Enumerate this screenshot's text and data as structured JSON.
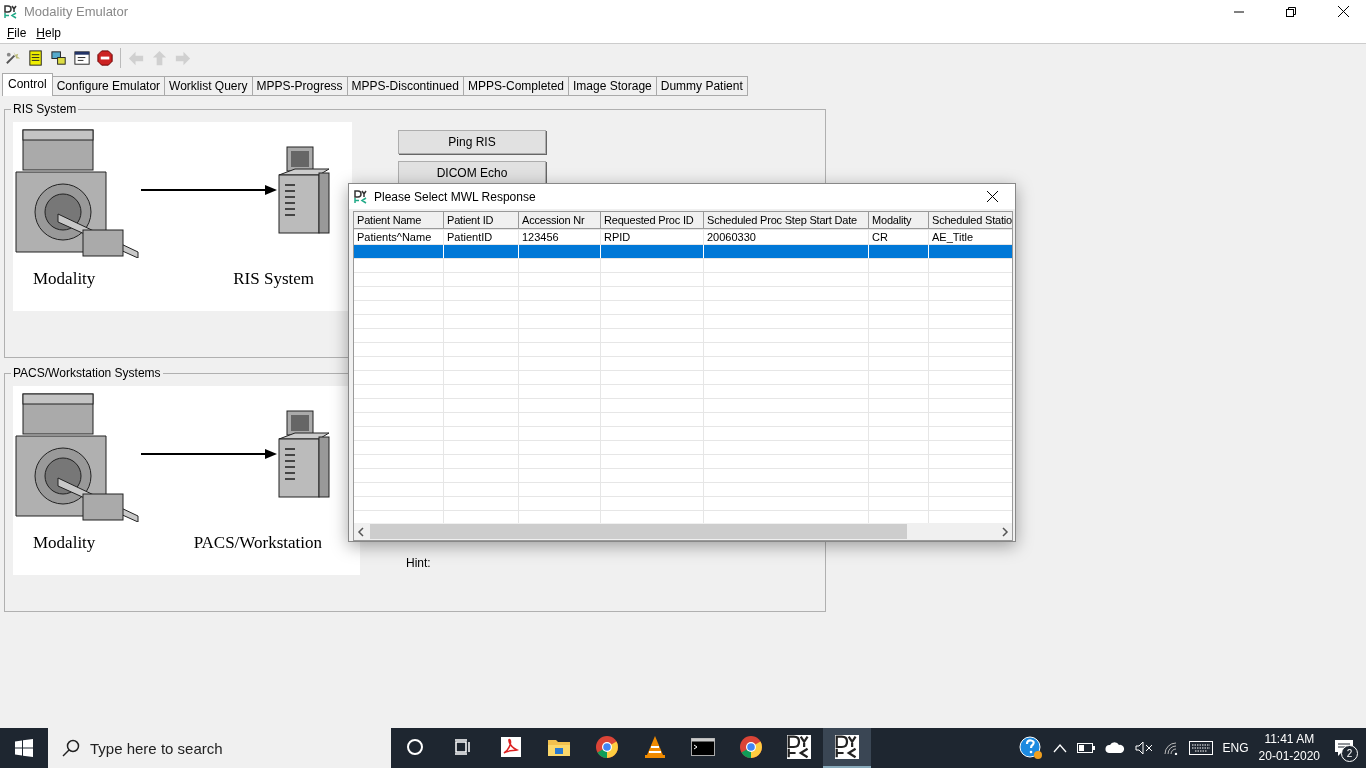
{
  "window": {
    "title": "Modality Emulator"
  },
  "menu": [
    "File",
    "Help"
  ],
  "toolbar": [
    {
      "kind": "wizard",
      "disabled": false
    },
    {
      "kind": "list",
      "disabled": false
    },
    {
      "kind": "network",
      "disabled": false
    },
    {
      "kind": "form",
      "disabled": false
    },
    {
      "kind": "stop",
      "disabled": false
    },
    {
      "kind": "back",
      "disabled": true
    },
    {
      "kind": "up",
      "disabled": true
    },
    {
      "kind": "forward",
      "disabled": true
    }
  ],
  "tabs": [
    {
      "label": "Control",
      "selected": true
    },
    {
      "label": "Configure Emulator",
      "selected": false
    },
    {
      "label": "Worklist Query",
      "selected": false
    },
    {
      "label": "MPPS-Progress",
      "selected": false
    },
    {
      "label": "MPPS-Discontinued",
      "selected": false
    },
    {
      "label": "MPPS-Completed",
      "selected": false
    },
    {
      "label": "Image Storage",
      "selected": false
    },
    {
      "label": "Dummy Patient",
      "selected": false
    }
  ],
  "groups": [
    {
      "title": "RIS System",
      "source": "Modality",
      "target": "RIS System"
    },
    {
      "title": "PACS/Workstation Systems",
      "source": "Modality",
      "target": "PACS/Workstation"
    }
  ],
  "buttons": [
    "Ping RIS",
    "DICOM Echo"
  ],
  "hint_label": "Hint:",
  "dialog": {
    "title": "Please Select MWL Response",
    "columns": [
      "Patient Name",
      "Patient ID",
      "Accession Nr",
      "Requested Proc ID",
      "Scheduled Proc Step Start Date",
      "Modality",
      "Scheduled Statio"
    ],
    "rows": [
      {
        "cells": [
          "Patients^Name",
          "PatientID",
          "123456",
          "RPID",
          "20060330",
          "CR",
          "AE_Title"
        ],
        "selected": false
      },
      {
        "selected": true
      }
    ]
  },
  "taskbar": {
    "search_placeholder": "Type here to search",
    "apps": [
      {
        "kind": "cortana",
        "active": false
      },
      {
        "kind": "taskview",
        "active": false
      },
      {
        "kind": "pdf",
        "active": false
      },
      {
        "kind": "folder",
        "active": false
      },
      {
        "kind": "chrome",
        "active": false
      },
      {
        "kind": "vlc",
        "active": false
      },
      {
        "kind": "terminal",
        "active": false
      },
      {
        "kind": "chrome",
        "active": false
      },
      {
        "kind": "dytk",
        "active": false
      },
      {
        "kind": "dytk",
        "active": true
      }
    ],
    "language": "ENG",
    "time": "11:41 AM",
    "date": "20-01-2020",
    "notifications": "2"
  }
}
